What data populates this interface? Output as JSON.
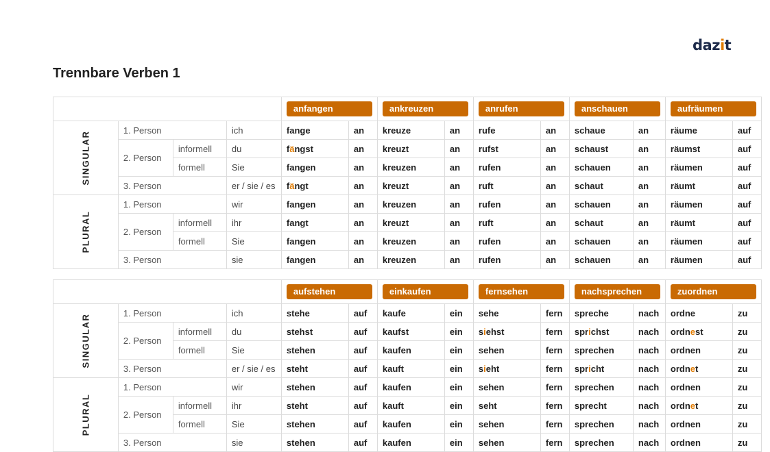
{
  "logo": {
    "pre": "daz",
    "accent": "i",
    "post": "t"
  },
  "title": "Trennbare Verben 1",
  "colors": {
    "badge": "#c96a03",
    "highlight": "#e07b00",
    "logo": "#1d2a4a"
  },
  "labels": {
    "singular": "SINGULAR",
    "plural": "PLURAL",
    "p1": "1. Person",
    "p2": "2. Person",
    "p3": "3. Person",
    "informell": "informell",
    "formell": "formell"
  },
  "pronouns": [
    "ich",
    "du",
    "Sie",
    "er / sie / es",
    "wir",
    "ihr",
    "Sie",
    "sie"
  ],
  "tables": [
    {
      "verbs": [
        {
          "name": "anfangen",
          "particle": "an",
          "forms": [
            "fange",
            "f[ä]ngst",
            "fangen",
            "f[ä]ngt",
            "fangen",
            "fangt",
            "fangen",
            "fangen"
          ]
        },
        {
          "name": "ankreuzen",
          "particle": "an",
          "forms": [
            "kreuze",
            "kreuzt",
            "kreuzen",
            "kreuzt",
            "kreuzen",
            "kreuzt",
            "kreuzen",
            "kreuzen"
          ]
        },
        {
          "name": "anrufen",
          "particle": "an",
          "forms": [
            "rufe",
            "rufst",
            "rufen",
            "ruft",
            "rufen",
            "ruft",
            "rufen",
            "rufen"
          ]
        },
        {
          "name": "anschauen",
          "particle": "an",
          "forms": [
            "schaue",
            "schaust",
            "schauen",
            "schaut",
            "schauen",
            "schaut",
            "schauen",
            "schauen"
          ]
        },
        {
          "name": "aufräumen",
          "particle": "auf",
          "forms": [
            "räume",
            "räumst",
            "räumen",
            "räumt",
            "räumen",
            "räumt",
            "räumen",
            "räumen"
          ]
        }
      ]
    },
    {
      "verbs": [
        {
          "name": "aufstehen",
          "particle": "auf",
          "forms": [
            "stehe",
            "stehst",
            "stehen",
            "steht",
            "stehen",
            "steht",
            "stehen",
            "stehen"
          ]
        },
        {
          "name": "einkaufen",
          "particle": "ein",
          "forms": [
            "kaufe",
            "kaufst",
            "kaufen",
            "kauft",
            "kaufen",
            "kauft",
            "kaufen",
            "kaufen"
          ]
        },
        {
          "name": "fernsehen",
          "particle": "fern",
          "forms": [
            "sehe",
            "s[i]ehst",
            "sehen",
            "s[i]eht",
            "sehen",
            "seht",
            "sehen",
            "sehen"
          ]
        },
        {
          "name": "nachsprechen",
          "particle": "nach",
          "forms": [
            "spreche",
            "spr[i]chst",
            "sprechen",
            "spr[i]cht",
            "sprechen",
            "sprecht",
            "sprechen",
            "sprechen"
          ]
        },
        {
          "name": "zuordnen",
          "particle": "zu",
          "forms": [
            "ordne",
            "ordn[e]st",
            "ordnen",
            "ordn[e]t",
            "ordnen",
            "ordn[e]t",
            "ordnen",
            "ordnen"
          ]
        }
      ]
    }
  ]
}
